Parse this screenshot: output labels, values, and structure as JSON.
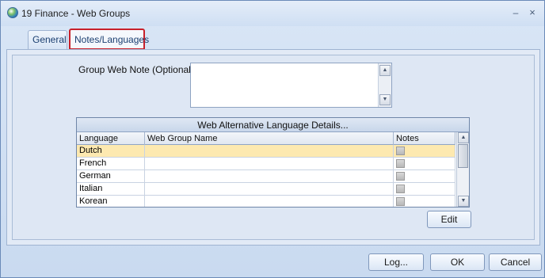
{
  "window": {
    "title": "19 Finance - Web Groups",
    "minimize_label": "–",
    "close_label": "×"
  },
  "tabs": [
    {
      "label": "General"
    },
    {
      "label": "Notes/Languages"
    }
  ],
  "note": {
    "label": "Group Web Note (Optional)",
    "value": ""
  },
  "grid": {
    "caption": "Web Alternative Language Details...",
    "columns": [
      "Language",
      "Web Group Name",
      "Notes"
    ],
    "rows": [
      {
        "language": "Dutch",
        "web_group_name": "",
        "notes": false
      },
      {
        "language": "French",
        "web_group_name": "",
        "notes": false
      },
      {
        "language": "German",
        "web_group_name": "",
        "notes": false
      },
      {
        "language": "Italian",
        "web_group_name": "",
        "notes": false
      },
      {
        "language": "Korean",
        "web_group_name": "",
        "notes": false
      }
    ],
    "selected_row": 0
  },
  "buttons": {
    "edit": "Edit",
    "log": "Log...",
    "ok": "OK",
    "cancel": "Cancel"
  },
  "colors": {
    "selected_row": "#fde9b0",
    "active_tab_border": "#c8202a"
  }
}
